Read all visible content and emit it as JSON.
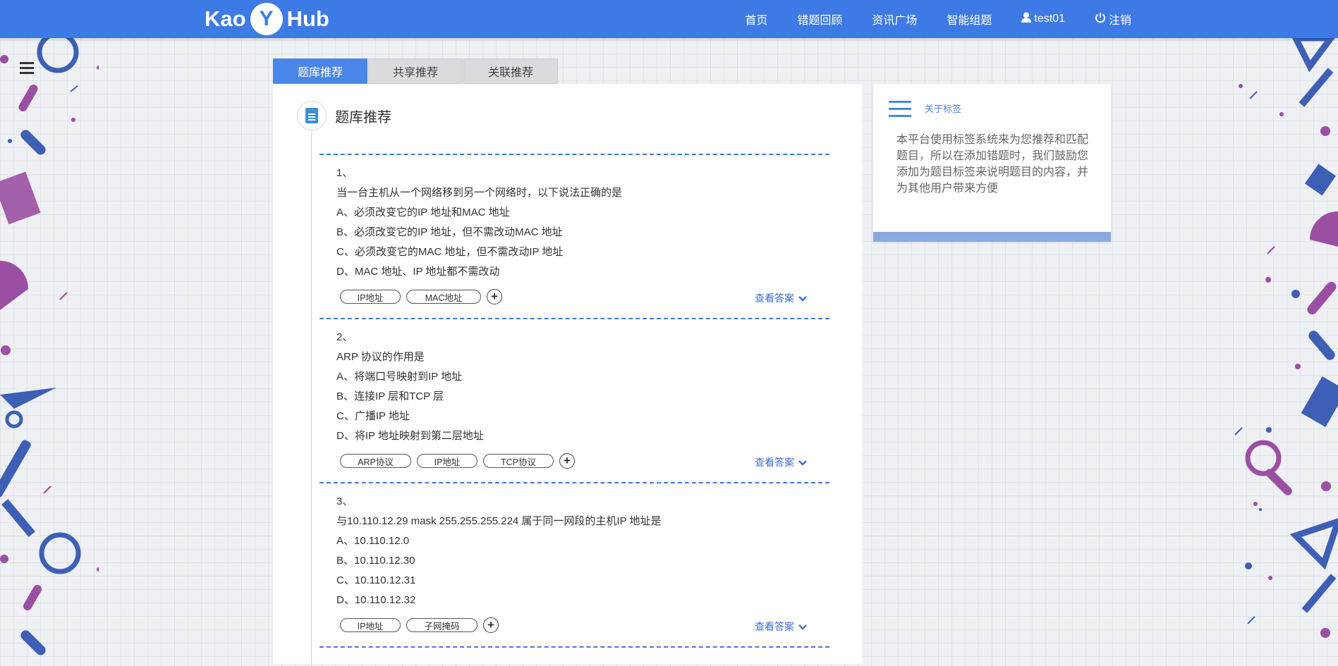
{
  "brand": {
    "left": "Kao",
    "middle": "Y",
    "right": "Hub"
  },
  "nav": {
    "items": [
      {
        "label": "首页",
        "icon": ""
      },
      {
        "label": "错题回顾",
        "icon": ""
      },
      {
        "label": "资讯广场",
        "icon": ""
      },
      {
        "label": "智能组题",
        "icon": ""
      },
      {
        "label": "test01",
        "icon": "user-icon"
      },
      {
        "label": "注销",
        "icon": "power-icon"
      }
    ]
  },
  "tabs": [
    {
      "label": "题库推荐",
      "active": true
    },
    {
      "label": "共享推荐",
      "active": false
    },
    {
      "label": "关联推荐",
      "active": false
    }
  ],
  "panel": {
    "title": "题库推荐"
  },
  "questions": [
    {
      "number": "1、",
      "stem": "当一台主机从一个网络移到另一个网络时，以下说法正确的是",
      "options": [
        "A、必须改变它的IP 地址和MAC 地址",
        "B、必须改变它的IP 地址，但不需改动MAC 地址",
        "C、必须改变它的MAC 地址，但不需改动IP 地址",
        "D、MAC 地址、IP 地址都不需改动"
      ],
      "tags": [
        "IP地址",
        "MAC地址"
      ],
      "answer_label": "查看答案"
    },
    {
      "number": "2、",
      "stem": "ARP 协议的作用是",
      "options": [
        "A、将端口号映射到IP 地址",
        "B、连接IP 层和TCP 层",
        "C、广播IP 地址",
        "D、将IP 地址映射到第二层地址"
      ],
      "tags": [
        "ARP协议",
        "IP地址",
        "TCP协议"
      ],
      "answer_label": "查看答案"
    },
    {
      "number": "3、",
      "stem": "与10.110.12.29 mask 255.255.255.224 属于同一网段的主机IP 地址是",
      "options": [
        "A、10.110.12.0",
        "B、10.110.12.30",
        "C、10.110.12.31",
        "D、10.110.12.32"
      ],
      "tags": [
        "IP地址",
        "子网掩码"
      ],
      "answer_label": "查看答案"
    }
  ],
  "sidebar": {
    "label": "关于标签",
    "text": "本平台使用标签系统来为您推荐和匹配题目，所以在添加错题时，我们鼓励您添加为题目标签来说明题目的内容，并为其他用户带来方便"
  },
  "colors": {
    "primary": "#3e7ae6",
    "tab_active": "#4a86e8",
    "purple": "#9b4fa3",
    "blue_deco": "#3d5fb5"
  }
}
